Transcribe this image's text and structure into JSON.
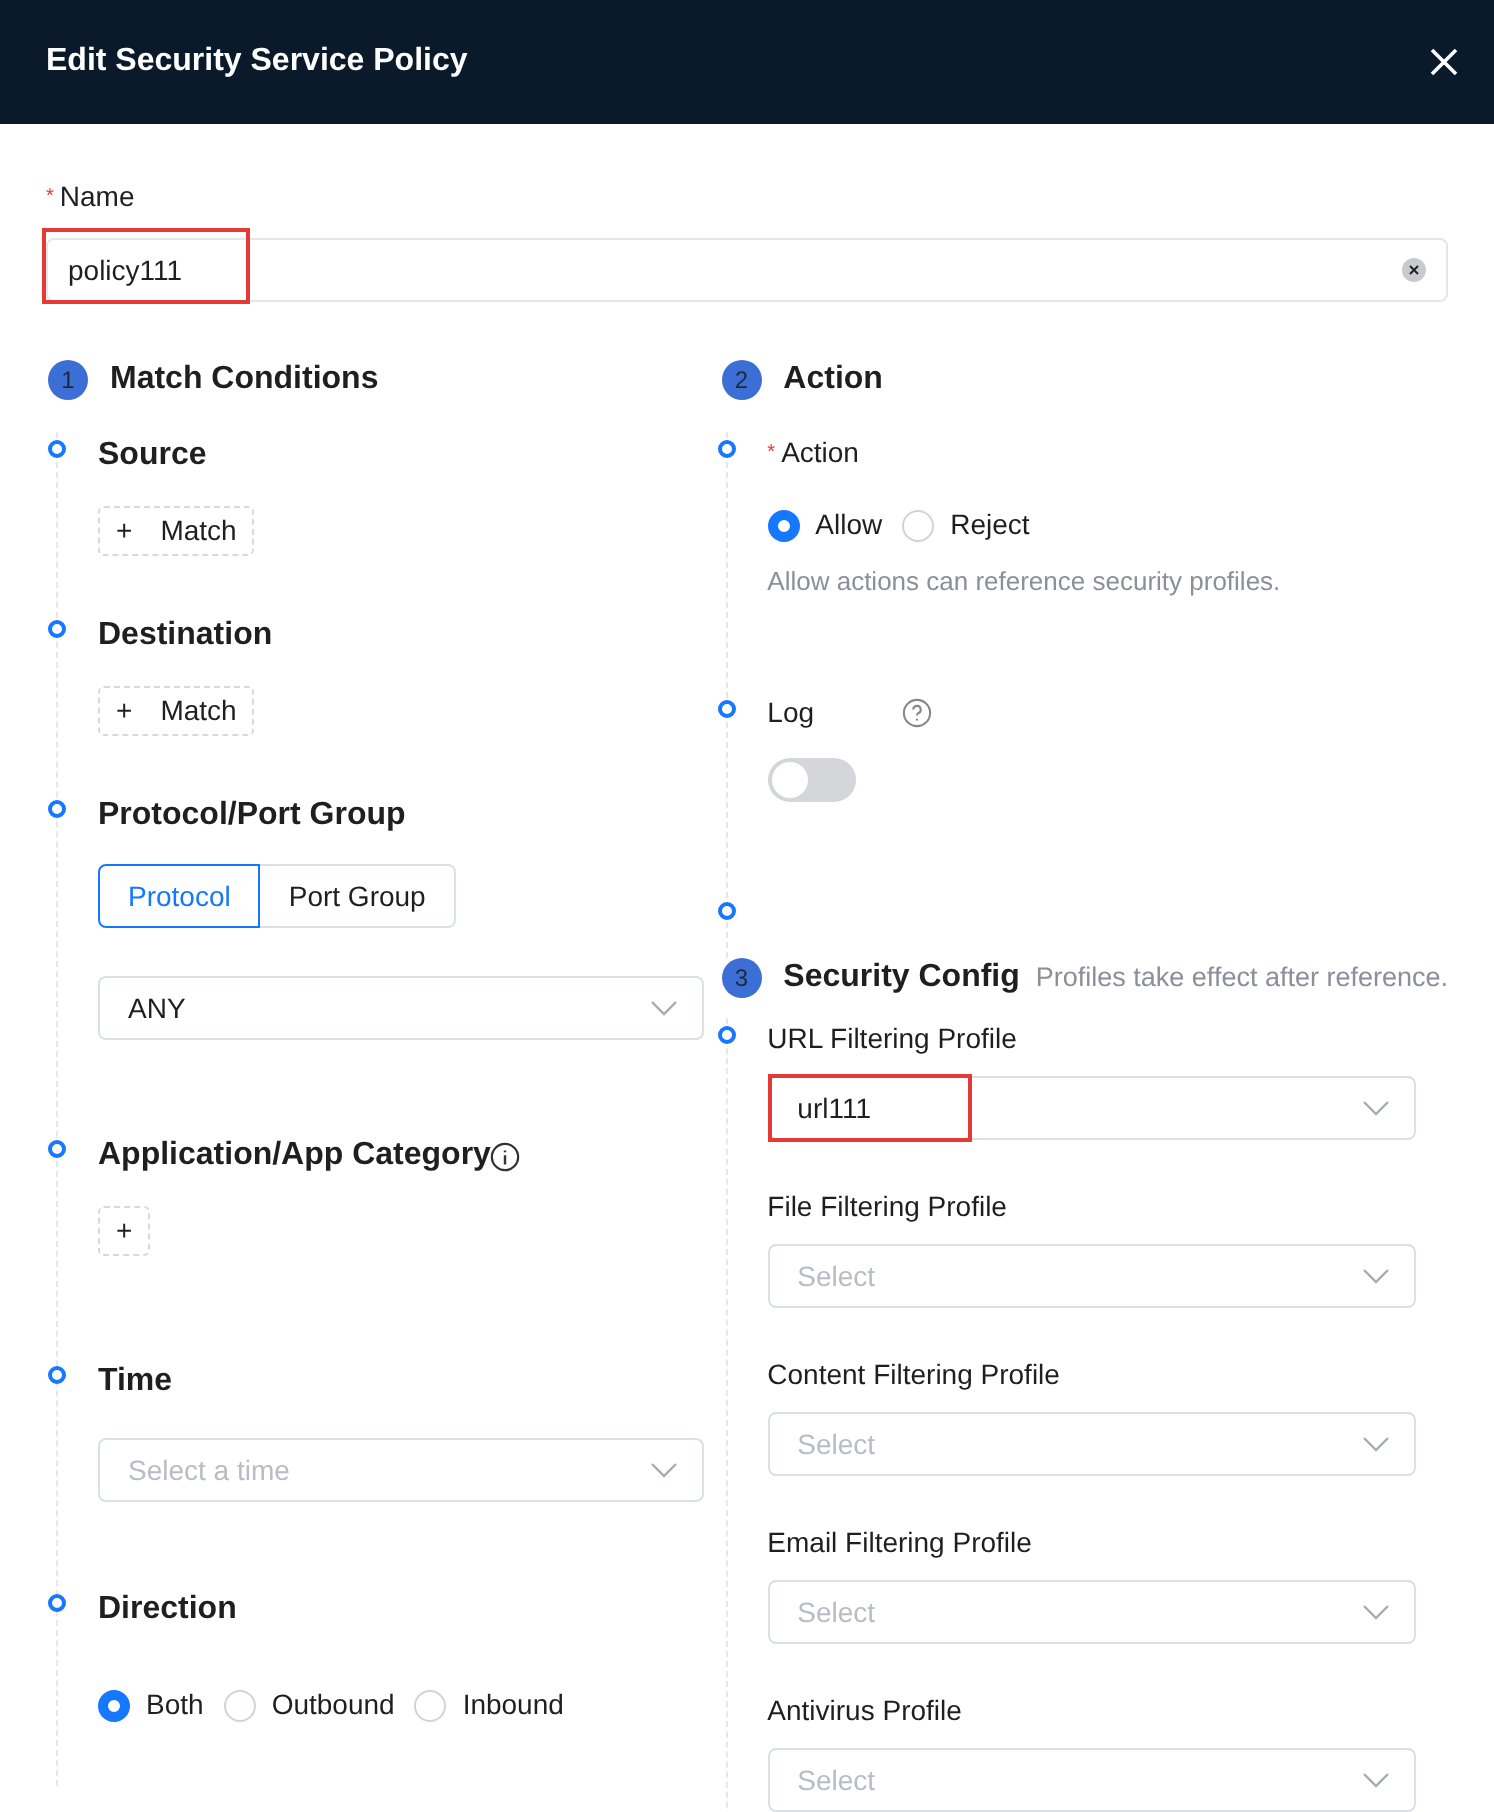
{
  "dialog": {
    "title": "Edit Security Service Policy"
  },
  "name_field": {
    "label": "Name",
    "required_mark": "*",
    "value": "policy111",
    "highlighted": true
  },
  "match_conditions": {
    "step": "1",
    "title": "Match Conditions",
    "items": [
      {
        "kind": "add",
        "label": "Source",
        "button_icon": "+",
        "button_label": "Match"
      },
      {
        "kind": "add",
        "label": "Destination",
        "button_icon": "+",
        "button_label": "Match"
      },
      {
        "kind": "segmented",
        "label": "Protocol/Port Group",
        "options": [
          {
            "label": "Protocol",
            "selected": true
          },
          {
            "label": "Port Group",
            "selected": false
          }
        ],
        "select_value": "ANY"
      },
      {
        "kind": "add",
        "label": "Application/App Category",
        "info": true,
        "button_icon": "+"
      },
      {
        "kind": "select",
        "label": "Time",
        "placeholder": "Select a time"
      },
      {
        "kind": "radio",
        "label": "Direction",
        "options": [
          {
            "label": "Both",
            "selected": true
          },
          {
            "label": "Outbound",
            "selected": false
          },
          {
            "label": "Inbound",
            "selected": false
          }
        ]
      }
    ]
  },
  "action": {
    "step": "2",
    "title": "Action",
    "action_field": {
      "label": "Action",
      "required_mark": "*",
      "options": [
        {
          "label": "Allow",
          "selected": true
        },
        {
          "label": "Reject",
          "selected": false
        }
      ],
      "hint": "Allow actions can reference security profiles."
    },
    "log": {
      "label": "Log",
      "on": false
    }
  },
  "security_config": {
    "step": "3",
    "title": "Security Config",
    "note": "Profiles take effect after reference.",
    "profiles": [
      {
        "label": "URL Filtering Profile",
        "value": "url111",
        "highlighted": true,
        "dot": true
      },
      {
        "label": "File Filtering Profile",
        "placeholder": "Select",
        "highlighted": false,
        "dot": false
      },
      {
        "label": "Content Filtering Profile",
        "placeholder": "Select",
        "highlighted": false,
        "dot": false
      },
      {
        "label": "Email Filtering Profile",
        "placeholder": "Select",
        "highlighted": false,
        "dot": false
      },
      {
        "label": "Antivirus Profile",
        "placeholder": "Select",
        "highlighted": false,
        "dot": false
      }
    ]
  }
}
